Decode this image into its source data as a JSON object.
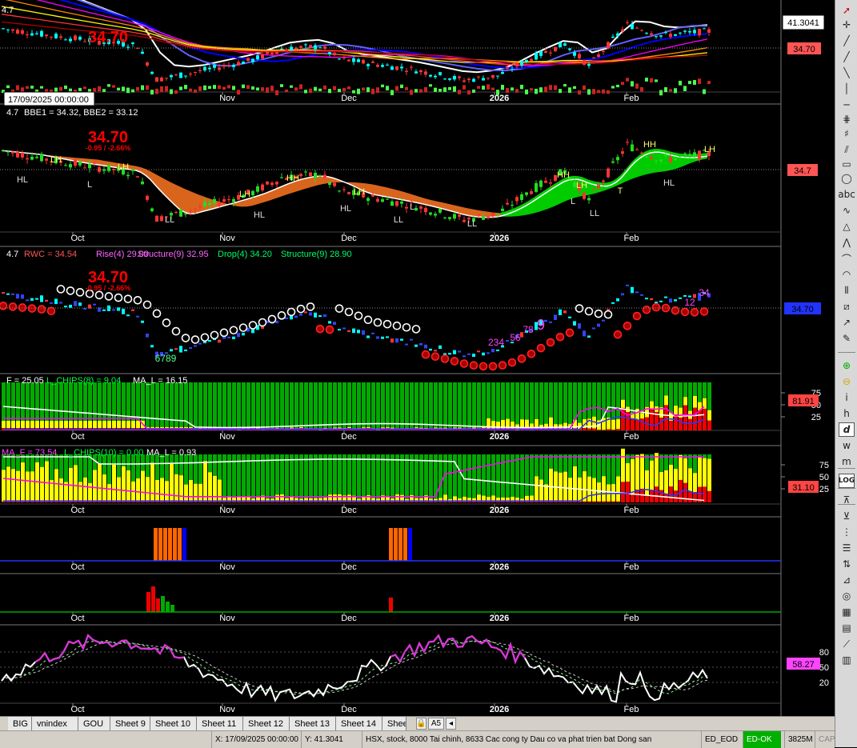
{
  "corner_label": "4.7",
  "date_tooltip": "17/09/2025 00:00:00",
  "value_box": "41.3041",
  "big_price": "34.70",
  "change_text": "-0.95 / -2.66%",
  "colors": {
    "bull": "#00ffff",
    "bear": "#ff3333",
    "green_bar": "#00cc00",
    "red": "#ff0000",
    "yellow": "#ffff00",
    "blue": "#0000ff",
    "magenta": "#ff00ff",
    "orange": "#ff6600"
  },
  "month_labels": {
    "oct": "Oct",
    "nov": "Nov",
    "dec": "Dec",
    "y2026": "2026",
    "feb": "Feb"
  },
  "panels": {
    "p1": {
      "right_label": "34.70"
    },
    "p2": {
      "header_prefix": "4.7",
      "header_bbe": "BBE1 = 34.32, BBE2 = 33.12",
      "right_label": "34.7",
      "swing_labels": {
        "lh": "LH",
        "hl": "HL",
        "hh": "HH",
        "ll": "LL",
        "l": "L",
        "t": "T",
        "h": "H"
      }
    },
    "p3": {
      "header_prefix": "4.7",
      "rwc": "RWC = 34.54",
      "rise": "Rise(4) 29.00",
      "structure1": "Structure(9) 32.95",
      "drop": "Drop(4) 34.20",
      "structure2": "Structure(9) 28.90",
      "right_label": "34.70",
      "count_labels": {
        "c6789": "6789",
        "c234": "234",
        "c56": "56",
        "c78": "78",
        "c9": "9",
        "c12": "12",
        "c34": "34",
        "c8": "8"
      }
    },
    "p4": {
      "header_f": "F = 25.05",
      "header_chips": "L_CHIPS(8) = 9.04",
      "header_mal": "MA_L = 16.15",
      "right_label": "81.91",
      "scale": [
        "75",
        "50",
        "25"
      ]
    },
    "p5": {
      "header_maf": "MA_F = 73.54",
      "header_chips": "L_CHIPS(10) = 0.00",
      "header_mal": "MA_L = 0.93",
      "right_label": "31.10",
      "scale": [
        "75",
        "50",
        "25"
      ]
    },
    "p8": {
      "right_label": "58.27",
      "scale": [
        "80",
        "50",
        "20"
      ]
    }
  },
  "sheet_tabs": [
    "BIG",
    "vnindex",
    "GOU",
    "Sheet 9",
    "Sheet 10",
    "Sheet 11",
    "Sheet 12",
    "Sheet 13",
    "Sheet 14",
    "Shee"
  ],
  "sheet_nav": {
    "lock": "🔒",
    "a5": "A5",
    "prev": "◂"
  },
  "status": {
    "x": "X: 17/09/2025 00:00:00",
    "y": "Y: 41.3041",
    "info": "HSX, stock, 8000 Tai chinh, 8633 Cac cong ty Dau co va phat trien bat Dong san",
    "ed": "ED_EOD",
    "ok": "ED-OK",
    "mem": "3825M",
    "cap": "CAP"
  },
  "toolbar_icons": [
    "cursor-icon",
    "crosshair-icon",
    "line-icon",
    "ray-icon",
    "trendline-icon",
    "vertical-line-icon",
    "horizontal-line-icon",
    "channel-icon",
    "fibonacci-icon",
    "pitchfork-icon",
    "rectangle-icon",
    "ellipse-icon",
    "text-icon",
    "wave-icon",
    "triangle-icon",
    "zigzag-icon",
    "arc-icon",
    "cycle-icon",
    "timezones-icon",
    "gann-icon",
    "arrow-icon",
    "style-icon",
    "zoom-in-icon",
    "zoom-out-icon",
    "italic-i-icon",
    "italic-h-icon",
    "italic-d-icon",
    "italic-w-icon",
    "italic-m-icon",
    "log-icon",
    "fit-icon",
    "move-down-icon",
    "bars-icon",
    "list-icon",
    "sort-icon",
    "fan-icon",
    "signal-icon",
    "grid-icon",
    "table-icon",
    "speed-lines-icon",
    "bars-2-icon"
  ]
}
